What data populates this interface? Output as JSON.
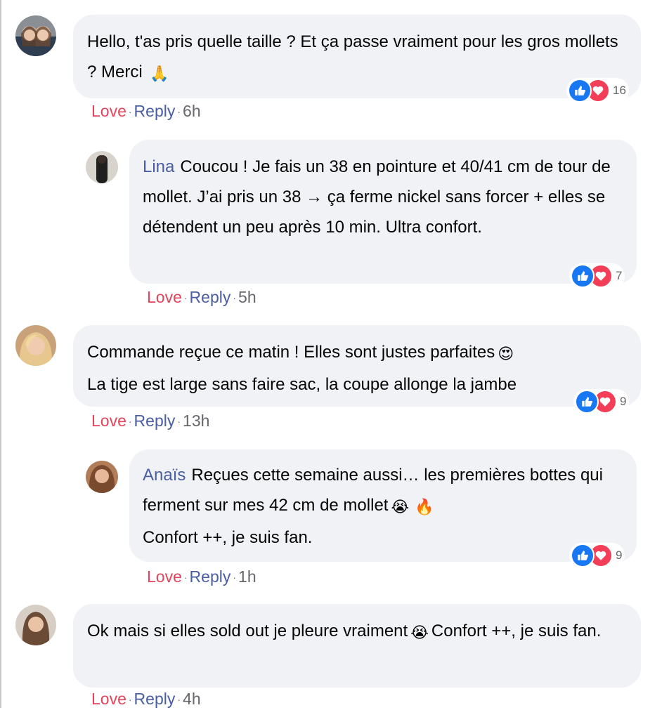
{
  "comments": [
    {
      "author": "",
      "text": "Hello, t'as pris quelle taille ? Et ça passe vraiment pour les gros mollets ? Merci",
      "emoji": "🙏",
      "reactions_count": "16",
      "love": "Love",
      "reply": "Reply",
      "time": "6h"
    },
    {
      "author": "Lina",
      "text": "Coucou ! Je fais un 38 en pointure et 40/41 cm de tour de mollet. J’ai pris un 38 → ça ferme nickel sans forcer + elles se détendent un peu après 10 min. Ultra confort.",
      "reactions_count": "7",
      "love": "Love",
      "reply": "Reply",
      "time": "5h"
    },
    {
      "author": "",
      "text": "Commande reçue ce matin ! Elles sont justes parfaites",
      "emoji": "😍",
      "text2": "La tige est large sans faire sac, la coupe allonge la jambe",
      "reactions_count": "9",
      "love": "Love",
      "reply": "Reply",
      "time": "13h"
    },
    {
      "author": "Anaïs",
      "text": "Reçues cette semaine aussi… les premières bottes qui ferment sur mes 42 cm de mollet",
      "emoji": "😭",
      "emoji2": "🔥",
      "text2": "Confort ++, je suis fan.",
      "reactions_count": "9",
      "love": "Love",
      "reply": "Reply",
      "time": "1h"
    },
    {
      "author": "",
      "text": "Ok mais si elles sold out je pleure vraiment",
      "emoji": "😭",
      "text2": "Confort ++, je suis fan.",
      "love": "Love",
      "reply": "Reply",
      "time": "4h"
    }
  ],
  "colors": {
    "like": "#1877f2",
    "love": "#f33e58",
    "bubble": "#f0f2f5",
    "link": "#4a5ea3",
    "love_text": "#e4455c"
  },
  "icons": {
    "like": "thumbs-up-icon",
    "love": "heart-icon"
  }
}
